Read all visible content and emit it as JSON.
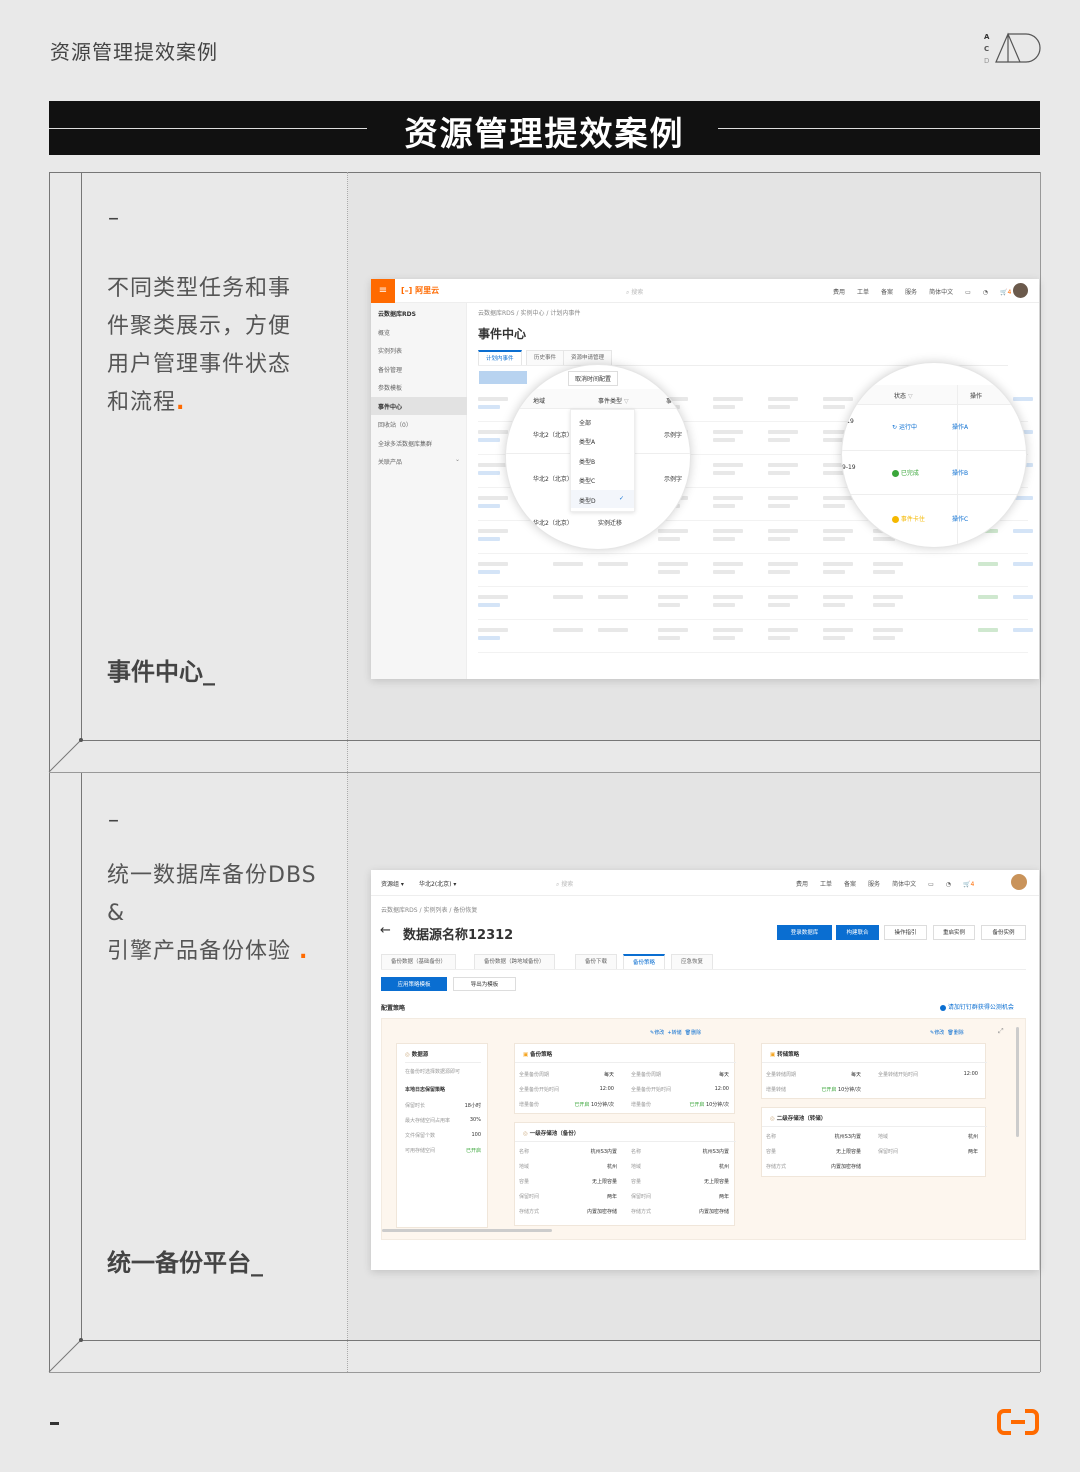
{
  "page": {
    "title": "资源管理提效案例",
    "logo_letters": "ACD",
    "banner_title": "资源管理提效案例"
  },
  "colors": {
    "accent": "#ff6a00",
    "primary_blue": "#0a6ed1",
    "success": "#3aa63a",
    "warning": "#f5b800"
  },
  "sections": [
    {
      "dash": "–",
      "desc_lines": [
        "不同类型任务和事",
        "件聚类展示，方便",
        "用户管理事件状态",
        "和流程"
      ],
      "dot": ".",
      "name": "事件中心_"
    },
    {
      "dash": "–",
      "desc_lines": [
        "统一数据库备份DBS",
        "&",
        "引擎产品备份体验"
      ],
      "dot": ".",
      "name": "统一备份平台_"
    }
  ],
  "event_center": {
    "brand": "阿里云",
    "search_placeholder": "搜索",
    "nav": [
      "费用",
      "工单",
      "备案",
      "服务",
      "简体中文"
    ],
    "cart_count": "4",
    "sidebar_title": "云数据库RDS",
    "sidebar": [
      "概览",
      "实例列表",
      "备份管理",
      "参数模板",
      "事件中心",
      "回收站（0）",
      "全球多活数据库集群",
      "关联产品"
    ],
    "breadcrumb": [
      "云数据库RDS",
      "实例中心",
      "计划内事件"
    ],
    "title": "事件中心",
    "tabs": [
      "计划内事件",
      "历史事件",
      "资源申请管理"
    ],
    "cancel_time_config": "取消时间配置",
    "left_zoom": {
      "headers": [
        "地域",
        "事件类型",
        "事"
      ],
      "rows": [
        [
          "华北2（北京）",
          "示例字"
        ],
        [
          "华北2（北京）",
          "示例字"
        ],
        [
          "华北2（北京）",
          "实例迁移"
        ]
      ],
      "dropdown": [
        "全部",
        "类型A",
        "类型B",
        "类型C",
        "类型D"
      ],
      "selected": "类型D"
    },
    "right_zoom": {
      "headers": [
        "状态",
        "操作"
      ],
      "fragments": [
        "-19",
        "9-19"
      ],
      "rows": [
        {
          "status": "运行中",
          "action": "操作A"
        },
        {
          "status": "已完成",
          "action": "操作B"
        },
        {
          "status": "事件卡住",
          "action": "操作C"
        }
      ]
    }
  },
  "backup": {
    "resource_group": "资源组",
    "region": "华北2(北京)",
    "search_placeholder": "搜索",
    "nav": [
      "费用",
      "工单",
      "备案",
      "服务",
      "简体中文"
    ],
    "cart_count": "4",
    "breadcrumb": [
      "云数据库RDS",
      "实例列表",
      "备份恢复"
    ],
    "title": "数据源名称12312",
    "actions": [
      "登录数据库",
      "构建联合",
      "操作指引",
      "重启实例",
      "备份实例"
    ],
    "tabs": [
      "备份数据（基础备份）",
      "备份数据（跨地域备份）",
      "备份下载",
      "备份策略",
      "应急恢复"
    ],
    "apply_template": "应用策略模板",
    "export_template": "导出为模板",
    "section_label": "配置策略",
    "notice": "请加钉钉群获得公测机会",
    "source_card": {
      "title": "数据源",
      "hint": "在备份时选择数据源即可",
      "subtitle": "本地日志保留策略",
      "rows": [
        [
          "保留时长",
          "18小时"
        ],
        [
          "最大存储空间占用率",
          "30%"
        ],
        [
          "文件保留个数",
          "100"
        ],
        [
          "可用存储空间",
          "已开启"
        ]
      ]
    },
    "mid_actions": [
      "修改",
      "转储",
      "删除"
    ],
    "policy_card": {
      "title": "备份策略",
      "rows": [
        [
          "全量备份周期",
          "每天"
        ],
        [
          "全量备份开始时间",
          "12:00"
        ],
        [
          "增量备份",
          "已开启",
          "10分钟/次"
        ]
      ]
    },
    "pool1_card": {
      "title": "一级存储池（备份）",
      "rows": [
        [
          "名称",
          "杭州S3内置"
        ],
        [
          "地域",
          "杭州"
        ],
        [
          "容量",
          "无上限容量"
        ],
        [
          "保留时间",
          "两年"
        ],
        [
          "存储方式",
          "内置加密存储"
        ]
      ]
    },
    "right_actions": [
      "修改",
      "删除"
    ],
    "transfer_card": {
      "title": "转储策略",
      "rows": [
        [
          "全量转储周期",
          "每天"
        ],
        [
          "全量转储开始时间",
          "12:00"
        ],
        [
          "增量转储",
          "已开启",
          "10分钟/次"
        ]
      ]
    },
    "pool2_card": {
      "title": "二级存储池（转储）",
      "rows": [
        [
          "名称",
          "杭州S3内置"
        ],
        [
          "地域",
          "杭州"
        ],
        [
          "容量",
          "无上限容量"
        ],
        [
          "保留时间",
          "两年"
        ],
        [
          "存储方式",
          "内置加密存储"
        ]
      ]
    }
  }
}
